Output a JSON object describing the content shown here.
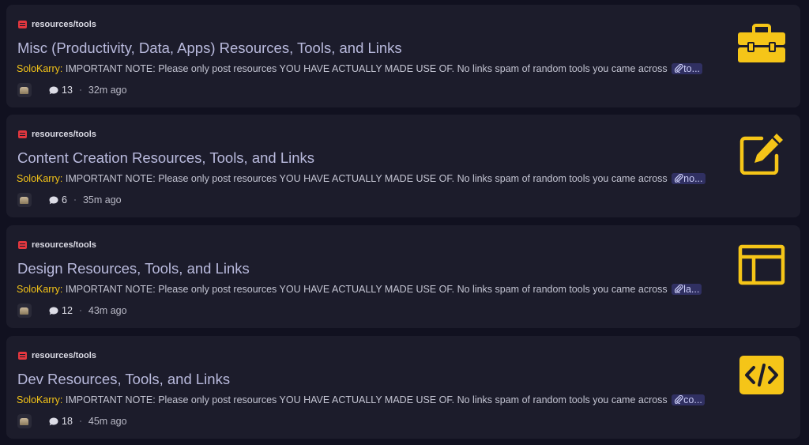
{
  "accent_color": "#f5c518",
  "tag_color": "#e2373f",
  "threads": [
    {
      "tag": "resources/tools",
      "title": "Misc (Productivity, Data, Apps) Resources, Tools, and Links",
      "author": "SoloKarry:",
      "preview": "IMPORTANT NOTE: Please only post resources YOU HAVE ACTUALLY MADE USE OF. No links spam of random tools you came across",
      "link_chip": "to...",
      "comment_count": "13",
      "time": "32m ago",
      "icon": "toolbox-icon"
    },
    {
      "tag": "resources/tools",
      "title": "Content Creation Resources, Tools, and Links",
      "author": "SoloKarry:",
      "preview": "IMPORTANT NOTE: Please only post resources YOU HAVE ACTUALLY MADE USE OF. No links spam of random tools you came across",
      "link_chip": "no...",
      "comment_count": "6",
      "time": "35m ago",
      "icon": "edit-icon"
    },
    {
      "tag": "resources/tools",
      "title": "Design Resources, Tools, and Links",
      "author": "SoloKarry:",
      "preview": "IMPORTANT NOTE: Please only post resources YOU HAVE ACTUALLY MADE USE OF. No links spam of random tools you came across",
      "link_chip": "la...",
      "comment_count": "12",
      "time": "43m ago",
      "icon": "layout-icon"
    },
    {
      "tag": "resources/tools",
      "title": "Dev Resources, Tools, and Links",
      "author": "SoloKarry:",
      "preview": "IMPORTANT NOTE: Please only post resources YOU HAVE ACTUALLY MADE USE OF. No links spam of random tools you came across",
      "link_chip": "co...",
      "comment_count": "18",
      "time": "45m ago",
      "icon": "code-icon"
    }
  ]
}
